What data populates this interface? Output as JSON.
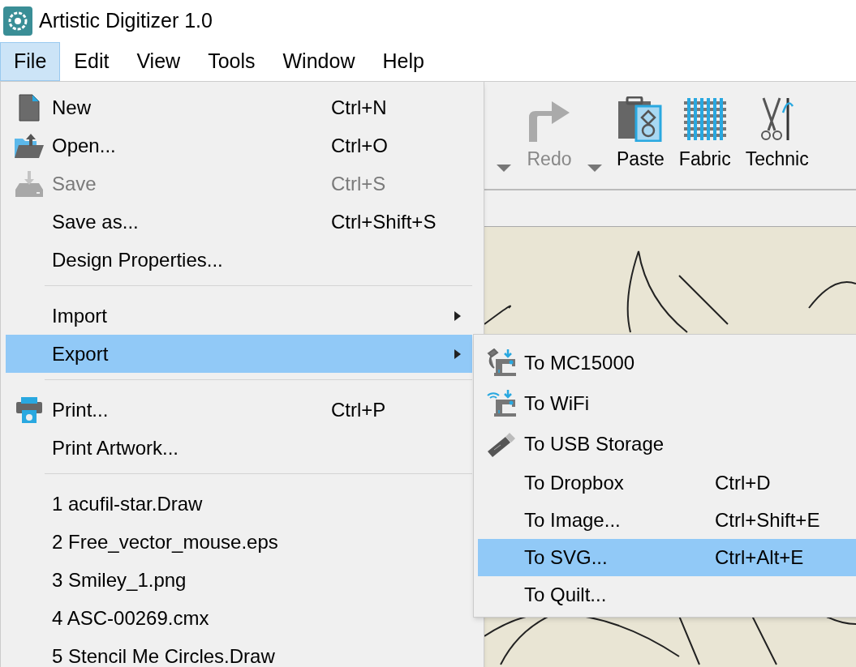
{
  "window": {
    "title": "Artistic Digitizer 1.0"
  },
  "menu_bar": [
    {
      "label": "File",
      "selected": true
    },
    {
      "label": "Edit",
      "selected": false
    },
    {
      "label": "View",
      "selected": false
    },
    {
      "label": "Tools",
      "selected": false
    },
    {
      "label": "Window",
      "selected": false
    },
    {
      "label": "Help",
      "selected": false
    }
  ],
  "toolbar": [
    {
      "kind": "caret"
    },
    {
      "kind": "button",
      "label": "Redo",
      "disabled": true
    },
    {
      "kind": "caret"
    },
    {
      "kind": "button",
      "label": "Paste",
      "disabled": false
    },
    {
      "kind": "button",
      "label": "Fabric",
      "disabled": false
    },
    {
      "kind": "button",
      "label": "Technic",
      "disabled": false
    }
  ],
  "file_menu": {
    "groups": [
      [
        {
          "label": "New",
          "shortcut": "Ctrl+N",
          "disabled": false,
          "has_submenu": false,
          "selected": false
        },
        {
          "label": "Open...",
          "shortcut": "Ctrl+O",
          "disabled": false,
          "has_submenu": false,
          "selected": false
        },
        {
          "label": "Save",
          "shortcut": "Ctrl+S",
          "disabled": true,
          "has_submenu": false,
          "selected": false
        },
        {
          "label": "Save as...",
          "shortcut": "Ctrl+Shift+S",
          "disabled": false,
          "has_submenu": false,
          "selected": false
        },
        {
          "label": "Design Properties...",
          "disabled": false,
          "has_submenu": false,
          "selected": false
        }
      ],
      [
        {
          "label": "Import",
          "disabled": false,
          "has_submenu": true,
          "selected": false
        },
        {
          "label": "Export",
          "disabled": false,
          "has_submenu": true,
          "selected": true
        }
      ],
      [
        {
          "label": "Print...",
          "shortcut": "Ctrl+P",
          "disabled": false,
          "has_submenu": false,
          "selected": false
        },
        {
          "label": "Print Artwork...",
          "disabled": false,
          "has_submenu": false,
          "selected": false
        }
      ],
      [
        {
          "label": "1 acufil-star.Draw",
          "disabled": false,
          "has_submenu": false,
          "selected": false
        },
        {
          "label": "2 Free_vector_mouse.eps",
          "disabled": false,
          "has_submenu": false,
          "selected": false
        },
        {
          "label": "3 Smiley_1.png",
          "disabled": false,
          "has_submenu": false,
          "selected": false
        },
        {
          "label": "4 ASC-00269.cmx",
          "disabled": false,
          "has_submenu": false,
          "selected": false
        },
        {
          "label": "5 Stencil Me Circles.Draw",
          "disabled": false,
          "has_submenu": false,
          "selected": false
        }
      ]
    ]
  },
  "export_submenu": [
    {
      "label": "To MC15000",
      "selected": false
    },
    {
      "label": "To WiFi",
      "selected": false
    },
    {
      "label": "To USB Storage",
      "selected": false
    },
    {
      "label": "To Dropbox",
      "shortcut": "Ctrl+D",
      "selected": false
    },
    {
      "label": "To Image...",
      "shortcut": "Ctrl+Shift+E",
      "selected": false
    },
    {
      "label": "To SVG...",
      "shortcut": "Ctrl+Alt+E",
      "selected": true
    },
    {
      "label": "To Quilt...",
      "selected": false
    }
  ]
}
